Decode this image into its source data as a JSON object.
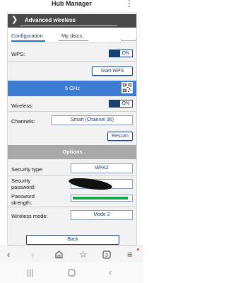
{
  "app": {
    "title": "Hub Manager",
    "menu_icon": "kebab-menu-icon"
  },
  "section": {
    "title": "Advanced wireless",
    "icon": "chevron-right-icon"
  },
  "tabs": [
    {
      "label": "Configuration",
      "active": true
    },
    {
      "label": "My discs",
      "active": false
    }
  ],
  "wps": {
    "label": "WPS:",
    "toggle": "ON",
    "action": "Start WPS"
  },
  "band": {
    "title": "5 GHz",
    "qr_icon": "qr-code-icon"
  },
  "wireless": {
    "label": "Wireless:",
    "toggle": "ON"
  },
  "channels": {
    "label": "Channels:",
    "value": "Smart (Channel 36)",
    "action": "Rescan"
  },
  "options": {
    "title": "Options",
    "security_type": {
      "label": "Security type:",
      "value": "WPA2"
    },
    "security_password": {
      "label": "Security password:"
    },
    "password_strength": {
      "label": "Password strength:",
      "level": 0.95
    },
    "wireless_mode": {
      "label": "Wireless mode:",
      "value": "Mode 2"
    }
  },
  "back": {
    "label": "Back"
  },
  "colors": {
    "accent": "#1c3f73",
    "band": "#3e7bd3",
    "options": "#a8a8a8",
    "strength": "#19a64a"
  },
  "browser": {
    "icons": [
      "back-icon",
      "forward-icon",
      "home-icon",
      "bookmark-star-icon",
      "tabs-icon",
      "menu-icon"
    ],
    "tabs_count": "3"
  },
  "system_nav": {
    "icons": [
      "recents-icon",
      "home-circle-icon",
      "back-nav-icon"
    ]
  }
}
